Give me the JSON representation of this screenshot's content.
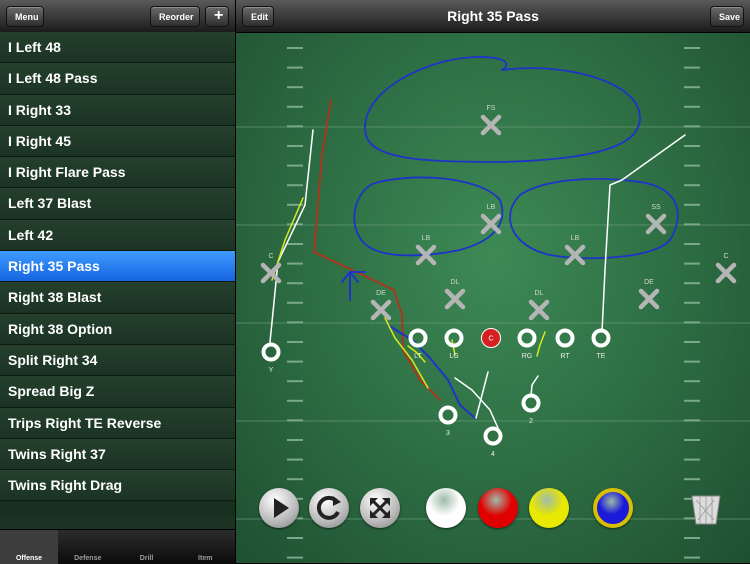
{
  "sidebar": {
    "menu_label": "Menu",
    "reorder_label": "Reorder",
    "add_label": "+",
    "plays": [
      "I Left 48",
      "I Left 48 Pass",
      "I Right 33",
      "I Right 45",
      "I Right Flare Pass",
      "Left 37 Blast",
      "Left 42",
      "Right 35 Pass",
      "Right 38 Blast",
      "Right 38 Option",
      "Split Right 34",
      "Spread Big Z",
      "Trips Right TE Reverse",
      "Twins Right 37",
      "Twins Right Drag"
    ],
    "selected_index": 7,
    "tabs": [
      "Offense",
      "Defense",
      "Drill",
      "Item"
    ],
    "active_tab": 0
  },
  "header": {
    "edit_label": "Edit",
    "title": "Right 35 Pass",
    "save_label": "Save"
  },
  "defense": [
    "FS",
    "LB",
    "LB",
    "SS",
    "LB",
    "C",
    "DL",
    "DL",
    "DE",
    "DE",
    "C"
  ],
  "offense": [
    "LT",
    "LG",
    "C",
    "RG",
    "RT",
    "TE",
    "Y",
    "3",
    "2",
    "4"
  ],
  "colors": {
    "route_white": "#ffffff",
    "route_yellow": "#d8e81e",
    "route_red": "#b2321b",
    "route_blue": "#1f33c9",
    "center_fill": "#d42020",
    "selected_row": "#2a7ff5",
    "color_buttons": [
      "#ffffff",
      "#e00000",
      "#e8e800",
      "#1a1ad8"
    ]
  },
  "toolbar_icons": [
    "play-icon",
    "refresh-icon",
    "fullscreen-icon",
    "trash-icon"
  ]
}
